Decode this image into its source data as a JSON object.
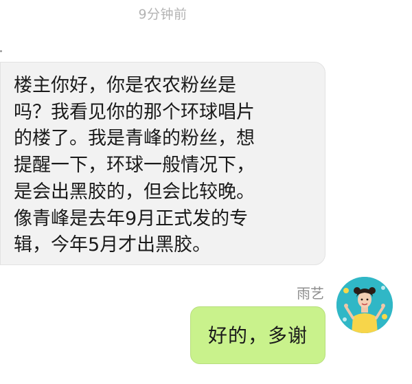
{
  "chat": {
    "timestamp": "9分钟前",
    "messages": [
      {
        "direction": "incoming",
        "text": "楼主你好，你是农农粉丝是\n吗？我看见你的那个环球唱片\n的楼了。我是青峰的粉丝，想\n提醒一下，环球一般情况下，\n是会出黑胶的，但会比较晚。\n像青峰是去年9月正式发的专\n辑，今年5月才出黑胶。"
      },
      {
        "direction": "outgoing",
        "sender": "雨艺",
        "text": "好的，多谢",
        "avatar": "user-avatar"
      }
    ]
  },
  "colors": {
    "background": "#ffffff",
    "incoming_bubble": "#f2f2f2",
    "outgoing_bubble": "#c9f28c",
    "timestamp_text": "#b3b3b3",
    "sender_name_text": "#8e8e8e",
    "avatar_background": "#30b7c6"
  }
}
